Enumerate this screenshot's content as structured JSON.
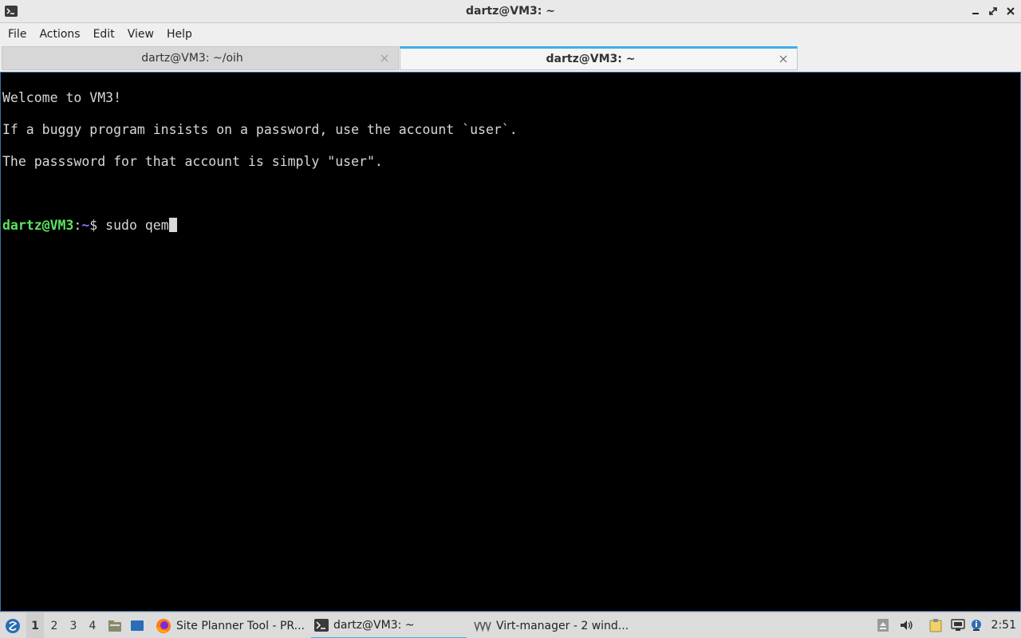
{
  "window": {
    "title": "dartz@VM3: ~"
  },
  "menubar": {
    "items": [
      "File",
      "Actions",
      "Edit",
      "View",
      "Help"
    ]
  },
  "tabs": [
    {
      "label": "dartz@VM3: ~/oih",
      "active": false
    },
    {
      "label": "dartz@VM3: ~",
      "active": true
    }
  ],
  "terminal": {
    "lines": [
      "Welcome to VM3!",
      "If a buggy program insists on a password, use the account `user`.",
      "The passsword for that account is simply \"user\".",
      ""
    ],
    "prompt": {
      "user_host": "dartz@VM3",
      "separator": ":",
      "path": "~",
      "symbol": "$ ",
      "command": "sudo qem"
    }
  },
  "taskbar": {
    "desktops": [
      "1",
      "2",
      "3",
      "4"
    ],
    "tasks": [
      {
        "label": "Site Planner Tool - PR..."
      },
      {
        "label": "dartz@VM3: ~"
      },
      {
        "label": "Virt-manager - 2 wind..."
      }
    ],
    "clock": "2:51"
  },
  "colors": {
    "accent": "#3daee9",
    "prompt_user": "#5ee35e",
    "prompt_path": "#7a7aff"
  }
}
